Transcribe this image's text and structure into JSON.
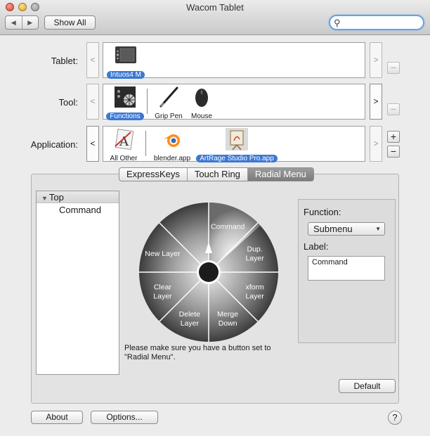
{
  "window": {
    "title": "Wacom Tablet"
  },
  "toolbar": {
    "back_label": "◀",
    "forward_label": "▶",
    "show_all_label": "Show All",
    "search_placeholder": ""
  },
  "rows": {
    "tablet": {
      "label": "Tablet:",
      "items": [
        {
          "label": "Intuos4 M",
          "selected": true,
          "icon": "tablet-icon"
        }
      ]
    },
    "tool": {
      "label": "Tool:",
      "items": [
        {
          "label": "Functions",
          "selected": true,
          "icon": "functions-icon"
        },
        {
          "label": "Grip Pen",
          "selected": false,
          "icon": "pen-icon"
        },
        {
          "label": "Mouse",
          "selected": false,
          "icon": "mouse-icon"
        }
      ]
    },
    "application": {
      "label": "Application:",
      "items": [
        {
          "label": "All Other",
          "selected": false,
          "icon": "all-apps-icon"
        },
        {
          "label": "blender.app",
          "selected": false,
          "icon": "blender-icon"
        },
        {
          "label": "ArtRage Studio Pro.app",
          "selected": true,
          "icon": "artrage-icon"
        }
      ]
    }
  },
  "arrows": {
    "left": "<",
    "right": ">"
  },
  "buttons": {
    "plus": "+",
    "minus": "−"
  },
  "tabs": [
    {
      "label": "ExpressKeys",
      "selected": false
    },
    {
      "label": "Touch Ring",
      "selected": false
    },
    {
      "label": "Radial Menu",
      "selected": true
    }
  ],
  "tree": {
    "top": "Top",
    "child": "Command"
  },
  "radial": {
    "segments": [
      "Command",
      "Dup. Layer",
      "xform Layer",
      "Merge Down",
      "Delete Layer",
      "Clear Layer",
      "New Layer"
    ],
    "selected": "Command"
  },
  "note": "Please make sure you have a button set to \"Radial Menu\".",
  "function": {
    "label": "Function:",
    "value": "Submenu",
    "label_label": "Label:",
    "label_value": "Command"
  },
  "footer": {
    "default_label": "Default",
    "about_label": "About",
    "options_label": "Options...",
    "help_label": "?"
  }
}
